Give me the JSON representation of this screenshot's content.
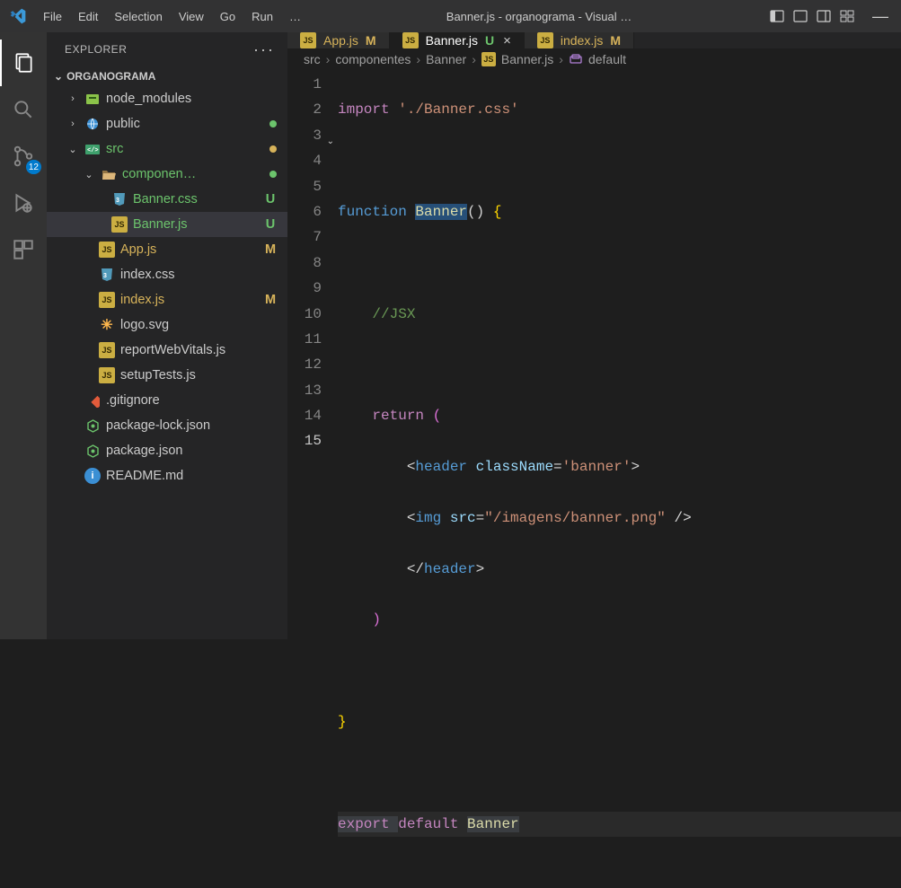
{
  "titlebar": {
    "menus": [
      "File",
      "Edit",
      "Selection",
      "View",
      "Go",
      "Run",
      "…"
    ],
    "title": "Banner.js - organograma - Visual …"
  },
  "activity": {
    "scm_badge": "12"
  },
  "sidebar": {
    "title": "EXPLORER",
    "folder": "ORGANOGRAMA",
    "tree": {
      "node_modules": "node_modules",
      "public": "public",
      "src": "src",
      "componen": "componen…",
      "banner_css": "Banner.css",
      "banner_js": "Banner.js",
      "app_js": "App.js",
      "index_css": "index.css",
      "index_js": "index.js",
      "logo_svg": "logo.svg",
      "report": "reportWebVitals.js",
      "setup": "setupTests.js",
      "gitignore": ".gitignore",
      "pkg_lock": "package-lock.json",
      "pkg": "package.json",
      "readme": "README.md",
      "status": {
        "U": "U",
        "M": "M"
      }
    }
  },
  "tabs": {
    "app": {
      "name": "App.js",
      "status": "M"
    },
    "banner": {
      "name": "Banner.js",
      "status": "U"
    },
    "index": {
      "name": "index.js",
      "status": "M"
    }
  },
  "breadcrumb": {
    "src": "src",
    "componentes": "componentes",
    "Banner": "Banner",
    "Bannerjs": "Banner.js",
    "default": "default"
  },
  "code": {
    "l1": {
      "import": "import ",
      "str": "'./Banner.css'"
    },
    "l3": {
      "function": "function ",
      "Banner": "Banner",
      "rest": "() "
    },
    "l5": {
      "comment": "//JSX"
    },
    "l7": {
      "return": "return "
    },
    "l8": {
      "header": "header",
      "className": " className",
      "eq": "=",
      "val": "'banner'"
    },
    "l9": {
      "img": "img",
      "src": " src",
      "eq": "=",
      "val": "\"/imagens/banner.png\"",
      "sp": " "
    },
    "l10": {
      "header": "header"
    },
    "l15": {
      "export": "export ",
      "default": "default ",
      "Banner": "Banner"
    }
  },
  "gutter": {
    "1": "1",
    "2": "2",
    "3": "3",
    "4": "4",
    "5": "5",
    "6": "6",
    "7": "7",
    "8": "8",
    "9": "9",
    "10": "10",
    "11": "11",
    "12": "12",
    "13": "13",
    "14": "14",
    "15": "15"
  }
}
